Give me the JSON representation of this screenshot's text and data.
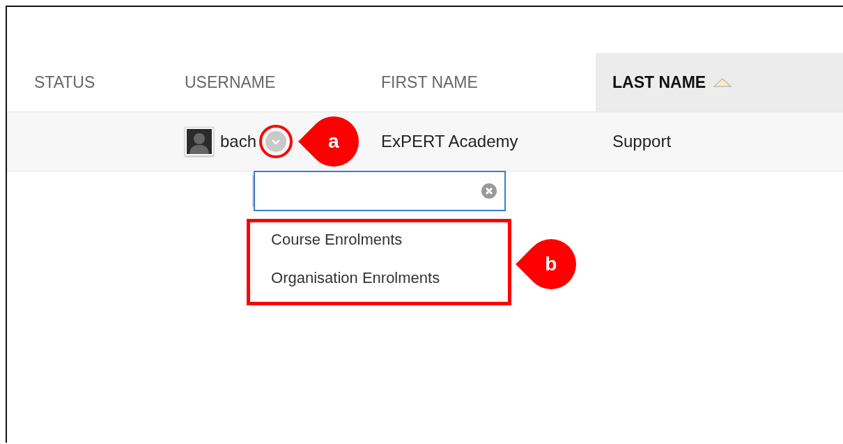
{
  "table": {
    "columns": [
      {
        "label": "STATUS",
        "sorted": false
      },
      {
        "label": "USERNAME",
        "sorted": false
      },
      {
        "label": "FIRST NAME",
        "sorted": false
      },
      {
        "label": "LAST NAME",
        "sorted": true
      }
    ],
    "rows": [
      {
        "username": "bach",
        "first_name": "ExPERT Academy",
        "last_name": "Support"
      }
    ]
  },
  "menu": {
    "items": [
      {
        "label": "Course Enrolments"
      },
      {
        "label": "Organisation Enrolments"
      }
    ]
  },
  "annotations": [
    {
      "kind": "button",
      "label": "a"
    },
    {
      "kind": "menu",
      "label": "b"
    }
  ]
}
